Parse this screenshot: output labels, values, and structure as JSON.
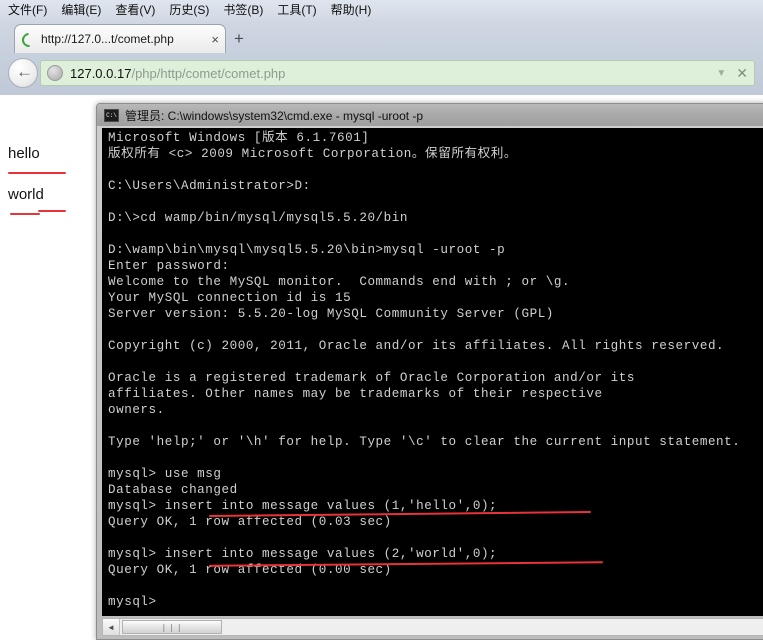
{
  "browser": {
    "menu_items": [
      "文件(F)",
      "编辑(E)",
      "查看(V)",
      "历史(S)",
      "书签(B)",
      "工具(T)",
      "帮助(H)"
    ],
    "tab": {
      "title": "http://127.0...t/comet.php",
      "close_label": "×",
      "favicon": "loading-spinner-icon"
    },
    "new_tab_label": "+",
    "back_label": "←",
    "url": {
      "host": "127.0.0.17",
      "path": "/php/http/comet/comet.php",
      "dropdown_label": "▼",
      "stop_label": "✕"
    }
  },
  "page": {
    "lines": [
      "hello",
      "world"
    ]
  },
  "console": {
    "title": "管理员: C:\\windows\\system32\\cmd.exe - mysql  -uroot -p",
    "icon_label": "C:\\",
    "output": "Microsoft Windows [版本 6.1.7601]\n版权所有 <c> 2009 Microsoft Corporation。保留所有权利。\n\nC:\\Users\\Administrator>D:\n\nD:\\>cd wamp/bin/mysql/mysql5.5.20/bin\n\nD:\\wamp\\bin\\mysql\\mysql5.5.20\\bin>mysql -uroot -p\nEnter password:\nWelcome to the MySQL monitor.  Commands end with ; or \\g.\nYour MySQL connection id is 15\nServer version: 5.5.20-log MySQL Community Server (GPL)\n\nCopyright (c) 2000, 2011, Oracle and/or its affiliates. All rights reserved.\n\nOracle is a registered trademark of Oracle Corporation and/or its\naffiliates. Other names may be trademarks of their respective\nowners.\n\nType 'help;' or '\\h' for help. Type '\\c' to clear the current input statement.\n\nmysql> use msg\nDatabase changed\nmysql> insert into message values (1,'hello',0);\nQuery OK, 1 row affected (0.03 sec)\n\nmysql> insert into message values (2,'world',0);\nQuery OK, 1 row affected (0.00 sec)\n\nmysql>",
    "scrollbar": {
      "left_arrow": "◄",
      "thumb_label": "❘❘❘"
    }
  },
  "annotations": {
    "color": "#e8333a"
  }
}
